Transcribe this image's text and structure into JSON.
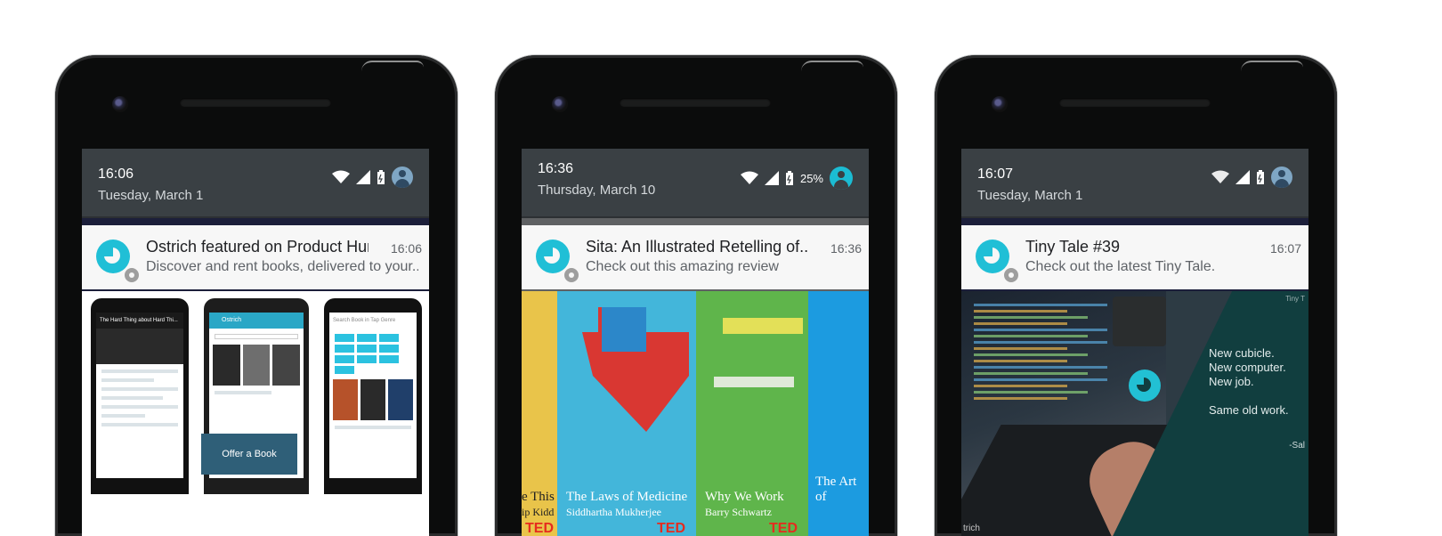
{
  "phones": [
    {
      "status": {
        "time": "16:06",
        "date": "Tuesday, March 1"
      },
      "notification": {
        "title": "Ostrich featured on Product Hunt",
        "time": "16:06",
        "text": "Discover and rent books, delivered to your.."
      },
      "media": {
        "mini1_title": "The Hard Thing about Hard Thi...",
        "mini2_title": "Ostrich",
        "mini3_title": "Search Book in Tap Genre",
        "offer_label": "Offer a Book"
      }
    },
    {
      "status": {
        "time": "16:36",
        "date": "Thursday, March 10",
        "battery": "25%"
      },
      "notification": {
        "title": "Sita: An Illustrated Retelling of..",
        "time": "16:36",
        "text": "Check out this amazing review"
      },
      "media": {
        "cover1_title": "e This",
        "cover1_sub": "ip Kidd",
        "cover2_title": "The Laws of Medicine",
        "cover2_sub": "Siddhartha Mukherjee",
        "cover3_title": "Why We Work",
        "cover3_sub": "Barry Schwartz",
        "cover4_title": "The Art of",
        "ted": "TED"
      }
    },
    {
      "status": {
        "time": "16:07",
        "date": "Tuesday, March 1"
      },
      "notification": {
        "title": "Tiny Tale #39",
        "time": "16:07",
        "text": "Check out the latest Tiny Tale."
      },
      "media": {
        "line1": "New cubicle.",
        "line2": "New computer.",
        "line3": "New job.",
        "line4": "Same old work.",
        "signature": "-Sal",
        "corner": "Tiny T",
        "watermark": "trich"
      }
    }
  ]
}
